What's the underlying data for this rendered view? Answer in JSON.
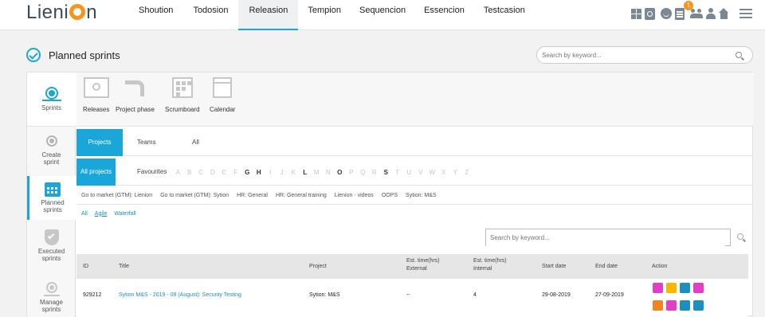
{
  "header": {
    "logo_text": "Lienion",
    "nav": [
      "Shoution",
      "Todosion",
      "Releasion",
      "Tempion",
      "Sequencion",
      "Essencion",
      "Testcasion"
    ],
    "active_nav": "Releasion",
    "notification_count": "1"
  },
  "page": {
    "title": "Planned sprints",
    "search_placeholder": "Search by keyword..."
  },
  "sidebar": {
    "items": [
      {
        "label": "Sprints",
        "icon": "sprints-icon"
      },
      {
        "label": "Create sprint",
        "icon": "create-sprint-icon"
      },
      {
        "label": "Planned sprints",
        "icon": "calendar-icon"
      },
      {
        "label": "Executed sprints",
        "icon": "shield-check-icon"
      },
      {
        "label": "Manage sprints",
        "icon": "manage-icon"
      }
    ]
  },
  "modules": [
    {
      "label": "Releases",
      "icon": "releases-icon"
    },
    {
      "label": "Project phase",
      "icon": "project-phase-icon"
    },
    {
      "label": "Scrumboard",
      "icon": "scrumboard-icon"
    },
    {
      "label": "Calendar",
      "icon": "calendar-icon"
    }
  ],
  "tabs": [
    "Projects",
    "Teams",
    "All"
  ],
  "subtabs": [
    "All projects",
    "Favourites"
  ],
  "letters": [
    "A",
    "B",
    "C",
    "D",
    "E",
    "F",
    "G",
    "H",
    "I",
    "J",
    "K",
    "L",
    "M",
    "N",
    "O",
    "P",
    "Q",
    "R",
    "S",
    "T",
    "U",
    "V",
    "W",
    "X",
    "Y",
    "Z"
  ],
  "active_letters": [
    "G",
    "H",
    "L",
    "O",
    "S"
  ],
  "project_filters": [
    "Go to market (GTM): Lienion",
    "Go to market (GTM): Sytion",
    "HR: General",
    "HR: General training",
    "Lienion - videos",
    "OOPS",
    "Sytion: M&S"
  ],
  "methodologies": [
    "All",
    "Agile",
    "Waterfall"
  ],
  "table": {
    "search_placeholder": "Search by keyword...",
    "columns": {
      "id": "ID",
      "title": "Title",
      "project": "Project",
      "ext_1": "Est. time(hrs)",
      "ext_2": "External",
      "int_1": "Est. time(hrs)",
      "int_2": "Internal",
      "start": "Start date",
      "end": "End date",
      "action": "Action"
    },
    "rows": [
      {
        "id": "929212",
        "title": "Sytion M&S - 2019 - 08 (August): Security Testing",
        "project": "Sytion: M&S",
        "est_external": "--",
        "est_internal": "4",
        "start": "29-08-2019",
        "end": "27-09-2019"
      }
    ]
  },
  "colors": {
    "accent": "#1aa6d9",
    "logo_orange": "#f7941d",
    "action_magenta": "#e040c8",
    "action_yellow": "#f5b800",
    "action_blue": "#1a8fc0",
    "action_orange": "#f58220"
  }
}
